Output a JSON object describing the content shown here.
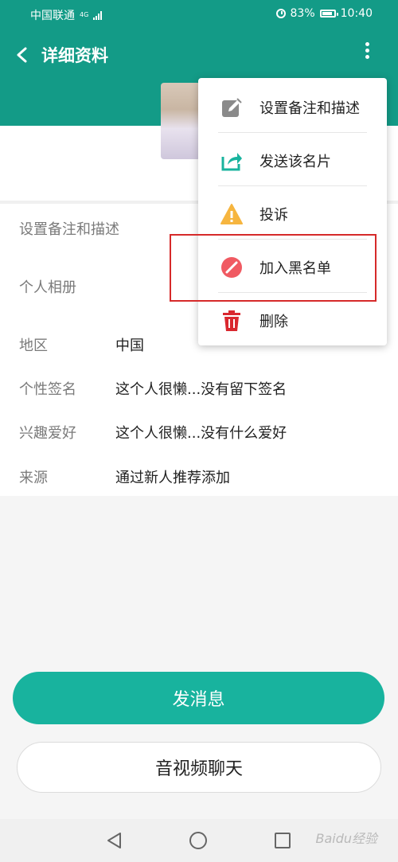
{
  "status_bar": {
    "carrier": "中国联通",
    "network": "4G",
    "battery": "83%",
    "battery_level": 0.83,
    "time": "10:40"
  },
  "header": {
    "title": "详细资料"
  },
  "profile": {
    "rows": [
      {
        "label": "设置备注和描述",
        "value": ""
      },
      {
        "label": "个人相册",
        "value": ""
      },
      {
        "label": "地区",
        "value": "中国"
      },
      {
        "label": "个性签名",
        "value": "这个人很懒...没有留下签名"
      },
      {
        "label": "兴趣爱好",
        "value": "这个人很懒...没有什么爱好"
      },
      {
        "label": "来源",
        "value": "通过新人推荐添加"
      }
    ]
  },
  "menu": {
    "items": [
      {
        "label": "设置备注和描述",
        "icon": "edit-icon",
        "color": "#8a8a8a"
      },
      {
        "label": "发送该名片",
        "icon": "share-icon",
        "color": "#18b39e"
      },
      {
        "label": "投诉",
        "icon": "warning-icon",
        "color": "#f6b53f"
      },
      {
        "label": "加入黑名单",
        "icon": "block-icon",
        "color": "#f05a62"
      },
      {
        "label": "删除",
        "icon": "trash-icon",
        "color": "#d9272e"
      }
    ]
  },
  "actions": {
    "send_message": "发消息",
    "av_chat": "音视频聊天"
  },
  "watermark": "Baidu经验",
  "colors": {
    "header": "#139b87",
    "primary_button": "#18b39e",
    "highlight": "#d62a2a"
  }
}
